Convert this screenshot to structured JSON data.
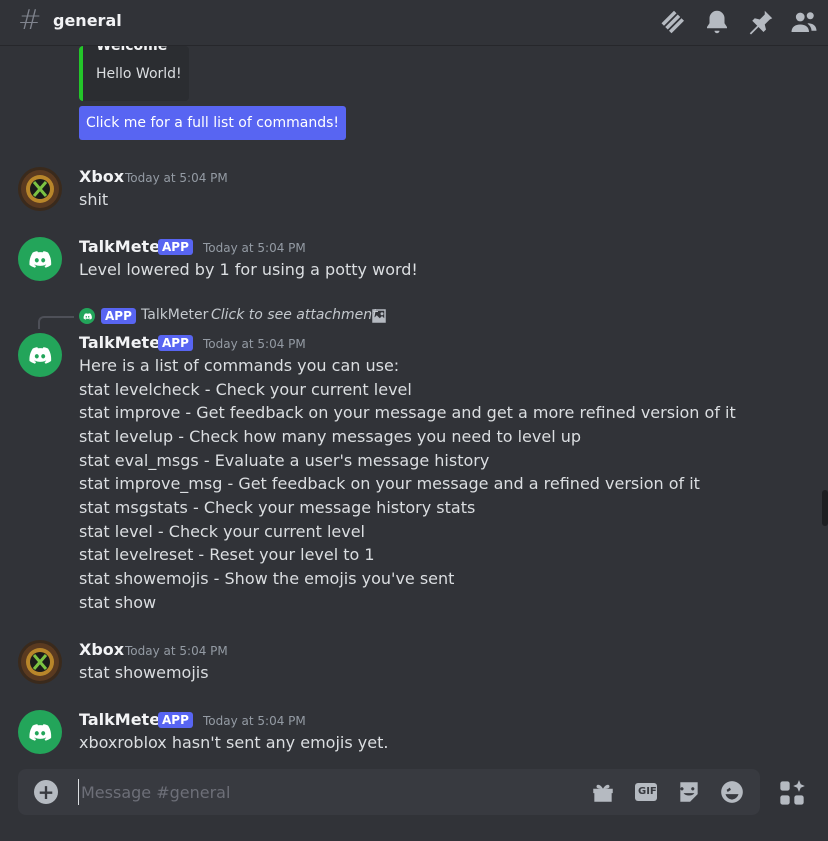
{
  "header": {
    "channel_name": "general",
    "icons": [
      "threads-icon",
      "bell-icon",
      "pin-icon",
      "members-icon"
    ]
  },
  "embed": {
    "title": "Welcome",
    "description": "Hello World!",
    "accent_color": "#23c629",
    "button_label": "Click me for a full list of commands!"
  },
  "messages": [
    {
      "username": "Xbox",
      "timestamp": "Today at 5:04 PM",
      "lines": [
        "shit"
      ]
    },
    {
      "username": "TalkMeter",
      "badge": "APP",
      "timestamp": "Today at 5:04 PM",
      "lines": [
        "Level lowered by 1 for using a potty word!"
      ]
    },
    {
      "reply": {
        "badge": "APP",
        "username": "TalkMeter",
        "text": "Click to see attachment"
      },
      "username": "TalkMeter",
      "badge": "APP",
      "timestamp": "Today at 5:04 PM",
      "lines": [
        "Here is a list of commands you can use:",
        "stat levelcheck - Check your current level",
        "stat improve - Get feedback on your message and get a more refined version of it",
        "stat levelup - Check how many messages you need to level up",
        "stat eval_msgs - Evaluate a user's message history",
        "stat improve_msg - Get feedback on your message and a refined version of it",
        "stat msgstats - Check your message history stats",
        "stat level - Check your current level",
        "stat levelreset - Reset your level to 1",
        "stat showemojis - Show the emojis you've sent",
        "stat show"
      ]
    },
    {
      "username": "Xbox",
      "timestamp": "Today at 5:04 PM",
      "lines": [
        "stat showemojis"
      ]
    },
    {
      "username": "TalkMeter",
      "badge": "APP",
      "timestamp": "Today at 5:04 PM",
      "lines": [
        "xboxroblox hasn't sent any emojis yet."
      ]
    }
  ],
  "composer": {
    "placeholder": "Message #general",
    "icons": [
      "gift-icon",
      "gif-icon",
      "sticker-icon",
      "emoji-icon",
      "apps-icon"
    ],
    "gif_label": "GIF"
  },
  "colors": {
    "background": "#313338",
    "brand": "#5865f2",
    "bot_avatar": "#23a55a"
  }
}
